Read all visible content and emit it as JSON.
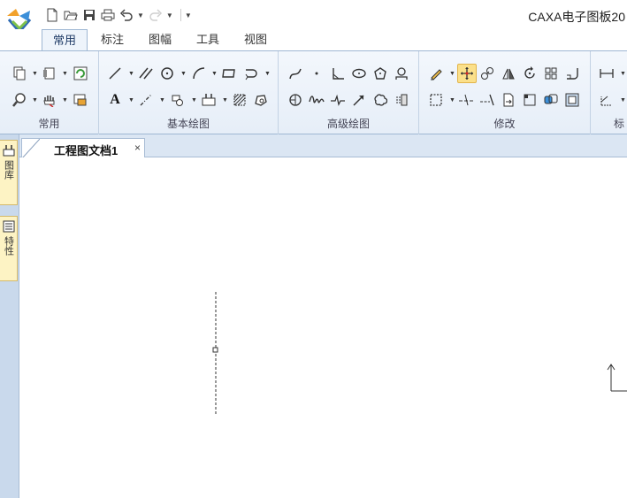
{
  "window": {
    "title": "CAXA电子图板20"
  },
  "ribbon_tabs": [
    "常用",
    "标注",
    "图幅",
    "工具",
    "视图"
  ],
  "active_tab": "常用",
  "ribbon_groups": {
    "common": "常用",
    "basic_draw": "基本绘图",
    "advanced_draw": "高级绘图",
    "modify": "修改",
    "annotate": "标"
  },
  "side_panel": {
    "tab1": "图库",
    "tab2": "特性"
  },
  "document": {
    "tab_title": "工程图文档1",
    "close_glyph": "×"
  },
  "text_tool_glyph": "A",
  "colors": {
    "ribbon_bg": "#e6eef8",
    "selected_tool": "#fbe08a",
    "side_panel": "#c9d9ec",
    "side_tab": "#fdf3c4"
  }
}
